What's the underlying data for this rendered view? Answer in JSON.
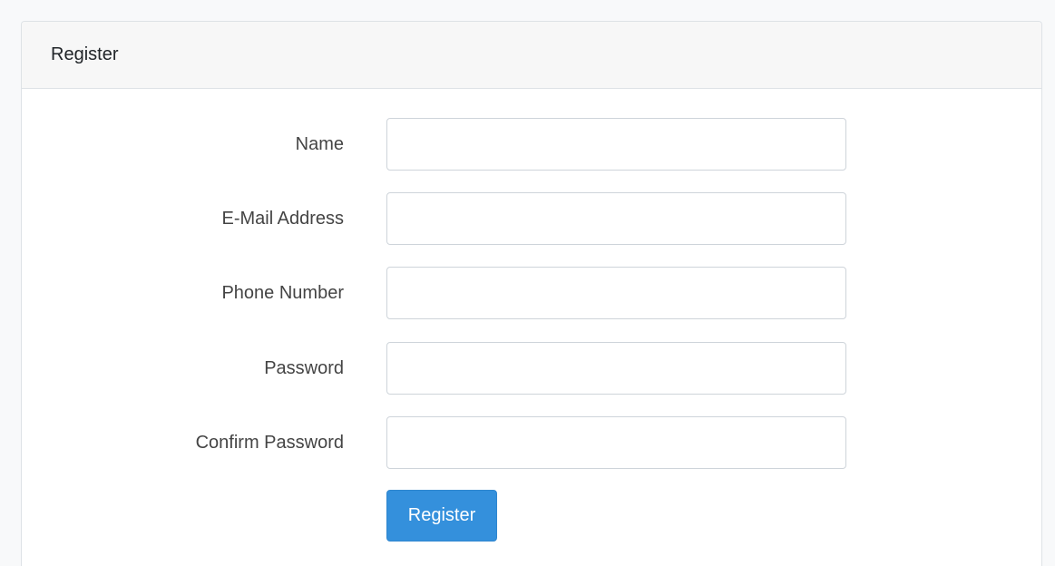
{
  "card": {
    "title": "Register"
  },
  "form": {
    "fields": [
      {
        "label": "Name",
        "value": "",
        "placeholder": ""
      },
      {
        "label": "E-Mail Address",
        "value": "",
        "placeholder": ""
      },
      {
        "label": "Phone Number",
        "value": "",
        "placeholder": ""
      },
      {
        "label": "Password",
        "value": "",
        "placeholder": ""
      },
      {
        "label": "Confirm Password",
        "value": "",
        "placeholder": ""
      }
    ],
    "submit_label": "Register"
  },
  "colors": {
    "primary": "#3490dc",
    "header_bg": "#f7f7f7",
    "border": "#dee2e6",
    "page_bg": "#f8f9fa"
  }
}
